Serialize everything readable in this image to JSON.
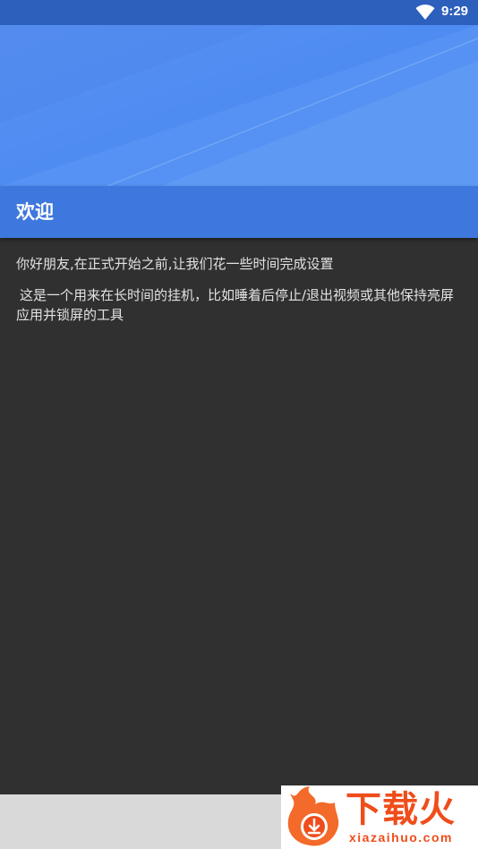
{
  "status_bar": {
    "time": "9:29",
    "wifi_icon": "wifi-icon",
    "background": "#2d5fbd"
  },
  "header": {
    "title": "欢迎",
    "background": "#3e77dd"
  },
  "content": {
    "greeting": "你好朋友,在正式开始之前,让我们花一些时间完成设置",
    "description": "这是一个用来在长时间的挂机，比如睡着后停止/退出视频或其他保持亮屏应用并锁屏的工具"
  },
  "watermark": {
    "brand": "下载火",
    "url": "xiazaihuo.com",
    "icon": "flame-download-icon",
    "color": "#ef4d1b"
  }
}
